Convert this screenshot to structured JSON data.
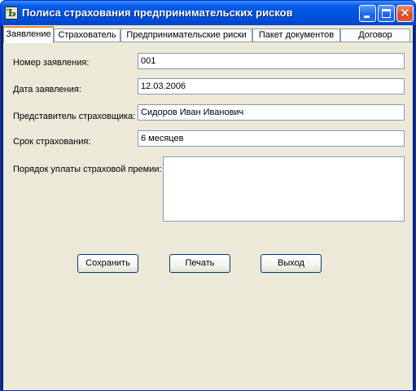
{
  "window": {
    "title": "Полиса страхования предпринимательских рисков",
    "app_icon_glyph": "Ъ",
    "close_glyph": "✕"
  },
  "tabs": [
    {
      "label": "Заявление",
      "active": true
    },
    {
      "label": "Страхователь",
      "active": false
    },
    {
      "label": "Предпринимательские риски",
      "active": false
    },
    {
      "label": "Пакет документов",
      "active": false
    },
    {
      "label": "Договор",
      "active": false
    }
  ],
  "form": {
    "application_number": {
      "label": "Номер заявления:",
      "value": "001"
    },
    "application_date": {
      "label": "Дата заявления:",
      "value": "12.03.2006"
    },
    "insurer_representative": {
      "label": "Представитель страховщика:",
      "value": "Сидоров Иван Иванович"
    },
    "insurance_term": {
      "label": "Срок страхования:",
      "value": "6 месяцев"
    },
    "premium_payment_order": {
      "label": "Порядок уплаты страховой премии:",
      "value": ""
    }
  },
  "buttons": {
    "save": "Сохранить",
    "print": "Печать",
    "exit": "Выход"
  },
  "colors": {
    "title_bar": "#0055e5",
    "window_bg": "#ece9d8",
    "active_tab_accent": "#e68b2c",
    "close_button": "#d64a25"
  }
}
